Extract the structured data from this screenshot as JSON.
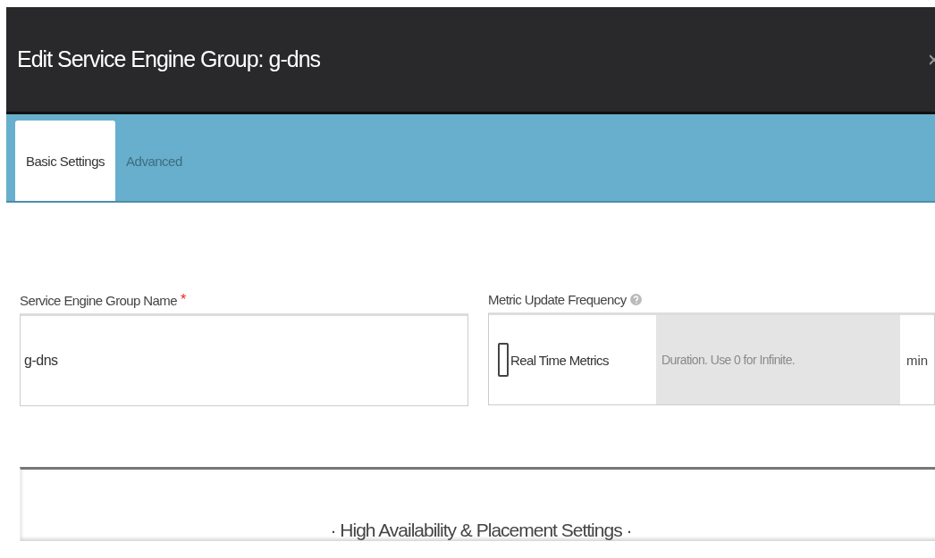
{
  "window": {
    "title": "Edit Service Engine Group: g-dns"
  },
  "tabs": [
    {
      "label": "Basic Settings",
      "selected": true
    },
    {
      "label": "Advanced",
      "selected": false
    }
  ],
  "fields": [
    {
      "kind": "text",
      "label": "Service Engine Group Name",
      "required_mark": "*",
      "value": "g-dns"
    },
    {
      "kind": "metric",
      "label": "Metric Update Frequency",
      "help": true,
      "checkbox_label": "Real Time Metrics",
      "checked": false,
      "placeholder": "Duration. Use 0 for Infinite.",
      "unit": "min"
    }
  ],
  "section": {
    "title": "· High Availability & Placement Settings ·"
  }
}
